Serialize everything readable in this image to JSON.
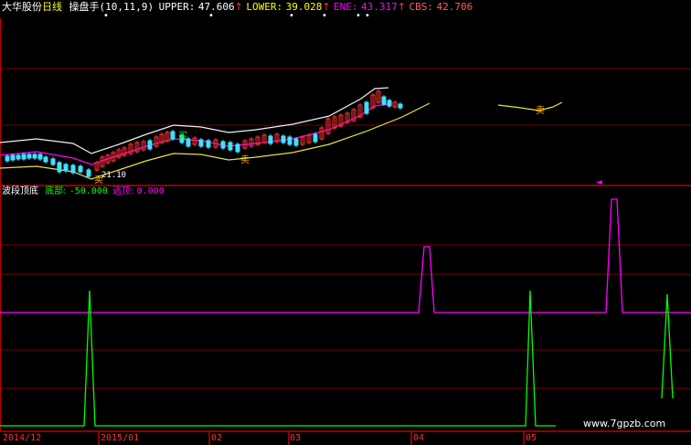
{
  "colors": {
    "background": "#000000",
    "grid": "#7a0000",
    "axis": "#c00000",
    "white": "#ffffff",
    "yellow": "#ffff00",
    "magenta": "#ff00ff",
    "green": "#00ff00",
    "pink": "#ff5d5d",
    "band_yellow": "#e8e040",
    "band_white": "#f0f0f0",
    "candle_up": "#ff3030",
    "candle_down": "#40e0ff"
  },
  "header": {
    "stock_name": "大华股份",
    "period": "日线",
    "indicator_name": "操盘手",
    "params": "(10,11,9)",
    "upper_label": "UPPER:",
    "upper_value": "47.606",
    "lower_label": "LOWER:",
    "lower_value": "39.028",
    "ene_label": "ENE:",
    "ene_value": "43.317",
    "cbs_label": "CBS:",
    "cbs_value": "42.706",
    "up_arrow": "↑",
    "dot_marker": "•"
  },
  "top_chart": {
    "low_price_label": "21.10",
    "buy_marker": "买",
    "sell_marker": "卖",
    "cursor_marker": "◄"
  },
  "sub_panel": {
    "title": "波段顶底",
    "bottom_label": "底部:",
    "bottom_value": "-50.000",
    "top_label": "逃顶:",
    "top_value": "0.000"
  },
  "x_axis": {
    "labels": [
      "2014/12",
      "2015/01",
      "02",
      "03",
      "04",
      "05"
    ]
  },
  "watermark": "www.7gpzb.com"
}
